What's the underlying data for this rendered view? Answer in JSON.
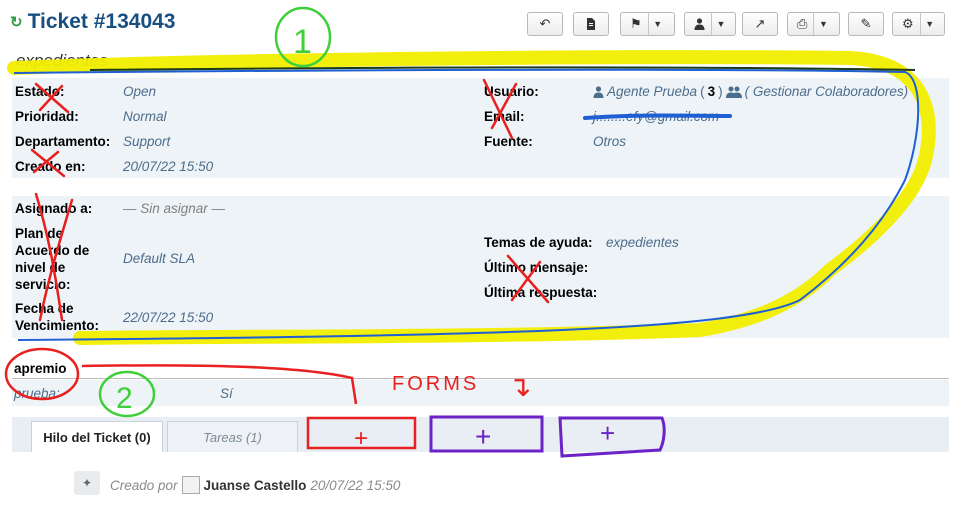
{
  "header": {
    "title": "Ticket #134043",
    "subject": "expedientes"
  },
  "toolbar": {
    "icons": [
      "reply-icon",
      "document-icon",
      "flag-icon",
      "user-icon",
      "share-icon",
      "print-icon",
      "edit-icon",
      "gear-icon"
    ]
  },
  "info": {
    "estado_label": "Estado:",
    "estado": "Open",
    "prioridad_label": "Prioridad:",
    "prioridad": "Normal",
    "departamento_label": "Departamento:",
    "departamento": "Support",
    "creado_label": "Creado en:",
    "creado": "20/07/22 15:50",
    "usuario_label": "Usuario:",
    "usuario": "Agente Prueba",
    "usuario_count_open": "(",
    "usuario_count": "3",
    "usuario_count_close": ")",
    "colaboradores": "( Gestionar Colaboradores)",
    "email_label": "Email:",
    "email": "j........efy@gmail.com",
    "fuente_label": "Fuente:",
    "fuente": "Otros"
  },
  "assign": {
    "asignado_label": "Asignado a:",
    "asignado": "— Sin asignar —",
    "plan_label_1": "Plan de",
    "plan_label_2": "Acuerdo de",
    "plan_label_3": "nivel de",
    "plan_label_4": "servicio:",
    "plan": "Default SLA",
    "fecha_label_1": "Fecha de",
    "fecha_label_2": "Vencimiento:",
    "fecha": "22/07/22 15:50",
    "temas_label": "Temas de ayuda:",
    "temas": "expedientes",
    "ultimo_mensaje_label": "Último mensaje:",
    "ultima_respuesta_label": "Última respuesta:"
  },
  "form": {
    "title": "apremio",
    "field_label": "prueba:",
    "field_value": "Sí"
  },
  "tabs": [
    {
      "label": "Hilo del Ticket (0)"
    },
    {
      "label": "Tareas (1)"
    }
  ],
  "thread": {
    "created_by_prefix": "Creado por",
    "author": "Juanse Castello",
    "timestamp": "20/07/22 15:50"
  },
  "annotations": {
    "num1": "1",
    "num2": "2",
    "forms_label": "FORMS",
    "arrow_char": "↴",
    "plus": "+",
    "colors": {
      "red": "#e8201f",
      "green": "#3fcf3a",
      "yellow": "#f2ee00",
      "blue": "#1f5fd4",
      "purple": "#6b22c7",
      "dark": "#1a3a1a"
    }
  }
}
